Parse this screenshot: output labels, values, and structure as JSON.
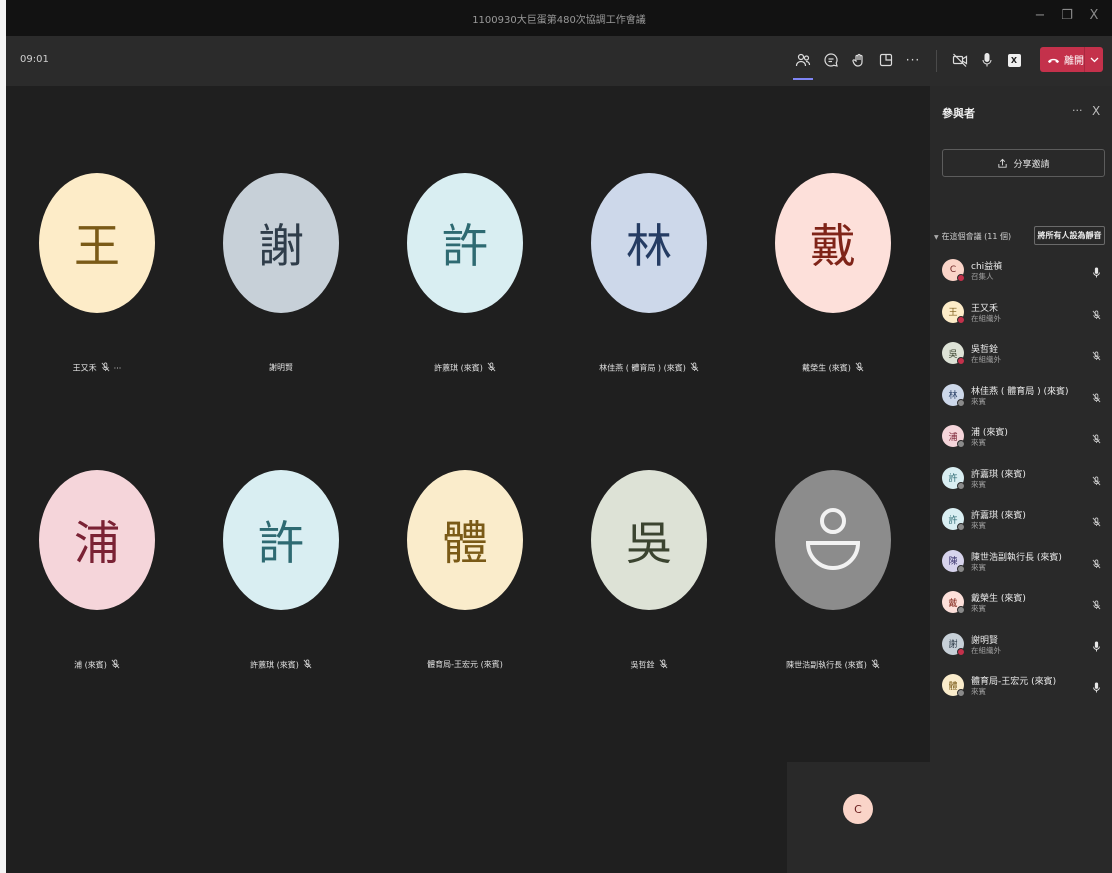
{
  "window": {
    "title": "1100930大巨蛋第480次協調工作會議",
    "minimize": "−",
    "restore": "❐",
    "close": "X"
  },
  "toolbar": {
    "timer": "09:01",
    "more_label": "···",
    "leave_label": "離開",
    "icons": [
      "participants-icon",
      "chat-icon",
      "reactions-icon",
      "rooms-icon",
      "more-icon",
      "camera-off-icon",
      "mic-icon",
      "share-tray-icon"
    ],
    "share_glyph": "X"
  },
  "colors": {
    "accent": "#7f85f5",
    "leave": "#c4314b",
    "status_red": "#c4314b",
    "status_grey": "#8a8a8a"
  },
  "tiles": [
    {
      "initial": "王",
      "name": "王又禾",
      "bg": "#fdecc8",
      "fg": "#7a5a17",
      "muted": true,
      "more": true
    },
    {
      "initial": "謝",
      "name": "謝明賢",
      "bg": "#c7d0d8",
      "fg": "#2f3d4a",
      "muted": false,
      "more": false
    },
    {
      "initial": "許",
      "name": "許䕒琪 (來賓)",
      "bg": "#d9eef2",
      "fg": "#2e6a72",
      "muted": true,
      "more": false
    },
    {
      "initial": "林",
      "name": "林佳燕 ( 體育局 ) (來賓)",
      "bg": "#cdd8ea",
      "fg": "#253c63",
      "muted": true,
      "more": false
    },
    {
      "initial": "戴",
      "name": "戴榮生 (來賓)",
      "bg": "#fde0da",
      "fg": "#7f2418",
      "muted": true,
      "more": false
    },
    {
      "initial": "浦",
      "name": "浦 (來賓)",
      "bg": "#f5d5da",
      "fg": "#7a2234",
      "muted": true,
      "more": false
    },
    {
      "initial": "許",
      "name": "許䕒琪 (來賓)",
      "bg": "#d9eef2",
      "fg": "#2e6a72",
      "muted": true,
      "more": false
    },
    {
      "initial": "體",
      "name": "體育局-王宏元 (來賓)",
      "bg": "#faeccb",
      "fg": "#7a5a17",
      "muted": false,
      "more": false
    },
    {
      "initial": "吳",
      "name": "吳哲銓",
      "bg": "#dde2d6",
      "fg": "#3b4430",
      "muted": true,
      "more": false
    },
    {
      "initial": "",
      "name": "陳世浩副執行長 (來賓)",
      "bg": "#8c8c8c",
      "fg": "#f2f2f2",
      "muted": true,
      "more": false,
      "placeholder": true
    }
  ],
  "self_view": {
    "initial": "C"
  },
  "panel": {
    "title": "參與者",
    "more": "···",
    "close": "X",
    "share_label": "分享邀請",
    "section_label": "在這個會議 (11 個)",
    "mute_all_label": "將所有人設為靜音",
    "participants": [
      {
        "initial": "C",
        "name": "chi益禎",
        "role": "召集人",
        "bg": "#fad4c8",
        "fg": "#6b1f1f",
        "status": "red",
        "mic": "on"
      },
      {
        "initial": "王",
        "name": "王又禾",
        "role": "在組織外",
        "bg": "#fdecc8",
        "fg": "#7a5a17",
        "status": "red",
        "mic": "off"
      },
      {
        "initial": "吳",
        "name": "吳哲銓",
        "role": "在組織外",
        "bg": "#dde2d6",
        "fg": "#3b4430",
        "status": "red",
        "mic": "off"
      },
      {
        "initial": "林",
        "name": "林佳燕 ( 體育局 ) (來賓)",
        "role": "來賓",
        "bg": "#cdd8ea",
        "fg": "#253c63",
        "status": "grey",
        "mic": "off"
      },
      {
        "initial": "浦",
        "name": "浦 (來賓)",
        "role": "來賓",
        "bg": "#f5d5da",
        "fg": "#7a2234",
        "status": "grey",
        "mic": "off"
      },
      {
        "initial": "許",
        "name": "許䕒琪 (來賓)",
        "role": "來賓",
        "bg": "#d9eef2",
        "fg": "#2e6a72",
        "status": "grey",
        "mic": "off"
      },
      {
        "initial": "許",
        "name": "許䕒琪 (來賓)",
        "role": "來賓",
        "bg": "#d9eef2",
        "fg": "#2e6a72",
        "status": "grey",
        "mic": "off"
      },
      {
        "initial": "陳",
        "name": "陳世浩副執行長 (來賓)",
        "role": "來賓",
        "bg": "#d7d3ec",
        "fg": "#3d3670",
        "status": "grey",
        "mic": "off"
      },
      {
        "initial": "戴",
        "name": "戴榮生 (來賓)",
        "role": "來賓",
        "bg": "#fde0da",
        "fg": "#7f2418",
        "status": "grey",
        "mic": "off"
      },
      {
        "initial": "謝",
        "name": "謝明賢",
        "role": "在組織外",
        "bg": "#c7d0d8",
        "fg": "#2f3d4a",
        "status": "red",
        "mic": "on"
      },
      {
        "initial": "體",
        "name": "體育局-王宏元 (來賓)",
        "role": "來賓",
        "bg": "#faeccb",
        "fg": "#7a5a17",
        "status": "grey",
        "mic": "on"
      }
    ]
  }
}
